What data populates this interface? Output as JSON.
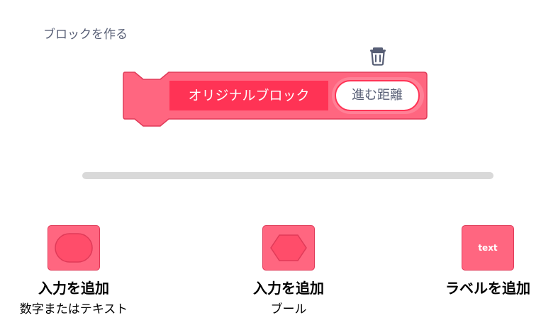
{
  "dialog": {
    "title": "ブロックを作る"
  },
  "block": {
    "label": "オリジナルブロック",
    "input_value": "進む距離"
  },
  "options": [
    {
      "title": "入力を追加",
      "subtitle": "数字またはテキスト",
      "icon": "rounded-input-icon"
    },
    {
      "title": "入力を追加",
      "subtitle": "ブール",
      "icon": "hexagon-input-icon"
    },
    {
      "title": "ラベルを追加",
      "subtitle": "",
      "icon": "text-label-icon",
      "tile_text": "text"
    }
  ],
  "colors": {
    "block_fill": "#ff6680",
    "block_stroke": "#e03a58",
    "block_label_bg": "#ff3355",
    "scrollbar": "#d9d9d9",
    "text_muted": "#575e75"
  }
}
